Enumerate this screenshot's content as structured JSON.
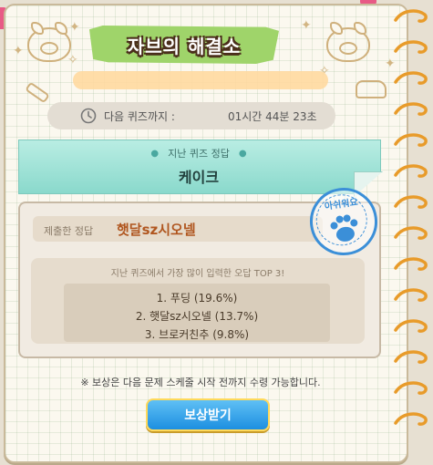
{
  "title": "자브의 해결소",
  "timer": {
    "label": "다음 퀴즈까지 :",
    "value": "01시간 44분 23초"
  },
  "last_answer": {
    "header": "지난 퀴즈 정답",
    "value": "케이크"
  },
  "submitted": {
    "label": "제출한 정답",
    "value": "햇달sz시오넬"
  },
  "stamp": {
    "text": "아쉬워요",
    "color": "#3b8fd8"
  },
  "top3": {
    "title": "지난 퀴즈에서 가장 많이 입력한 오답 TOP 3!",
    "items": [
      "1. 푸딩 (19.6%)",
      "2. 햇달sz시오넬 (13.7%)",
      "3. 브로커친추 (9.8%)"
    ]
  },
  "notice": "※ 보상은 다음 문제 스케줄 시작 전까지 수령 가능합니다.",
  "reward_button": "보상받기",
  "colors": {
    "accent": "#1d8fe0",
    "title_green": "#9fd46a",
    "answer_mint": "#8ad9cc",
    "spiral": "#e89b2a"
  },
  "icons": [
    "clock-icon",
    "paw-icon",
    "sparkle-icon",
    "pig-doodle",
    "bone-doodle",
    "car-doodle",
    "spiral-ring"
  ]
}
